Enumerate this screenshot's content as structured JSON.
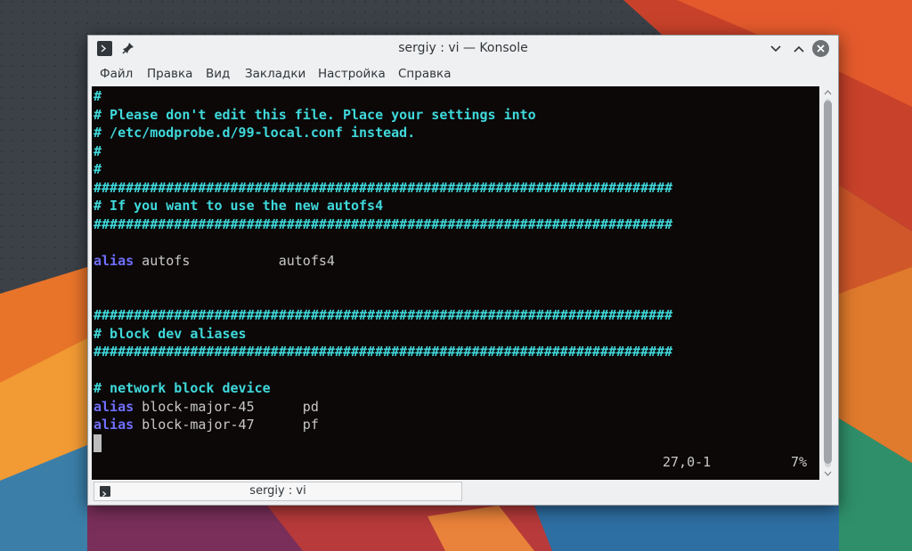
{
  "window": {
    "title": "sergiy : vi — Konsole"
  },
  "menu": {
    "items": [
      "Файл",
      "Правка",
      "Вид",
      "Закладки",
      "Настройка",
      "Справка"
    ]
  },
  "terminal": {
    "lines": [
      {
        "parts": [
          {
            "t": "#",
            "c": "comment"
          }
        ]
      },
      {
        "parts": [
          {
            "t": "# Please don't edit this file. Place your settings into",
            "c": "comment"
          }
        ]
      },
      {
        "parts": [
          {
            "t": "# /etc/modprobe.d/99-local.conf instead.",
            "c": "comment"
          }
        ]
      },
      {
        "parts": [
          {
            "t": "#",
            "c": "comment"
          }
        ]
      },
      {
        "parts": [
          {
            "t": "#",
            "c": "comment"
          }
        ]
      },
      {
        "parts": [
          {
            "t": "########################################################################",
            "c": "comment"
          }
        ]
      },
      {
        "parts": [
          {
            "t": "# If you want to use the new autofs4",
            "c": "comment"
          }
        ]
      },
      {
        "parts": [
          {
            "t": "########################################################################",
            "c": "comment"
          }
        ]
      },
      {
        "parts": []
      },
      {
        "parts": [
          {
            "t": "alias",
            "c": "keyword"
          },
          {
            "t": " autofs           autofs4",
            "c": "text"
          }
        ]
      },
      {
        "parts": []
      },
      {
        "parts": []
      },
      {
        "parts": [
          {
            "t": "########################################################################",
            "c": "comment"
          }
        ]
      },
      {
        "parts": [
          {
            "t": "# block dev aliases",
            "c": "comment"
          }
        ]
      },
      {
        "parts": [
          {
            "t": "########################################################################",
            "c": "comment"
          }
        ]
      },
      {
        "parts": []
      },
      {
        "parts": [
          {
            "t": "# network block device",
            "c": "comment"
          }
        ]
      },
      {
        "parts": [
          {
            "t": "alias",
            "c": "keyword"
          },
          {
            "t": " block-major-45      pd",
            "c": "text"
          }
        ]
      },
      {
        "parts": [
          {
            "t": "alias",
            "c": "keyword"
          },
          {
            "t": " block-major-47      pf",
            "c": "text"
          }
        ]
      }
    ],
    "status_position": "27,0-1",
    "status_percent": "7%"
  },
  "tab": {
    "label": "sergiy : vi"
  },
  "colors": {
    "comment": "#3fd9db",
    "keyword": "#6f6fff",
    "text": "#c8c8c8",
    "terminal_bg": "#0c0808"
  },
  "icons": {
    "window_app": "terminal-prompt-icon",
    "pin": "pin-icon",
    "minimize": "chevron-down-icon",
    "maximize": "chevron-up-icon",
    "close": "close-icon",
    "tab": "terminal-prompt-icon"
  }
}
